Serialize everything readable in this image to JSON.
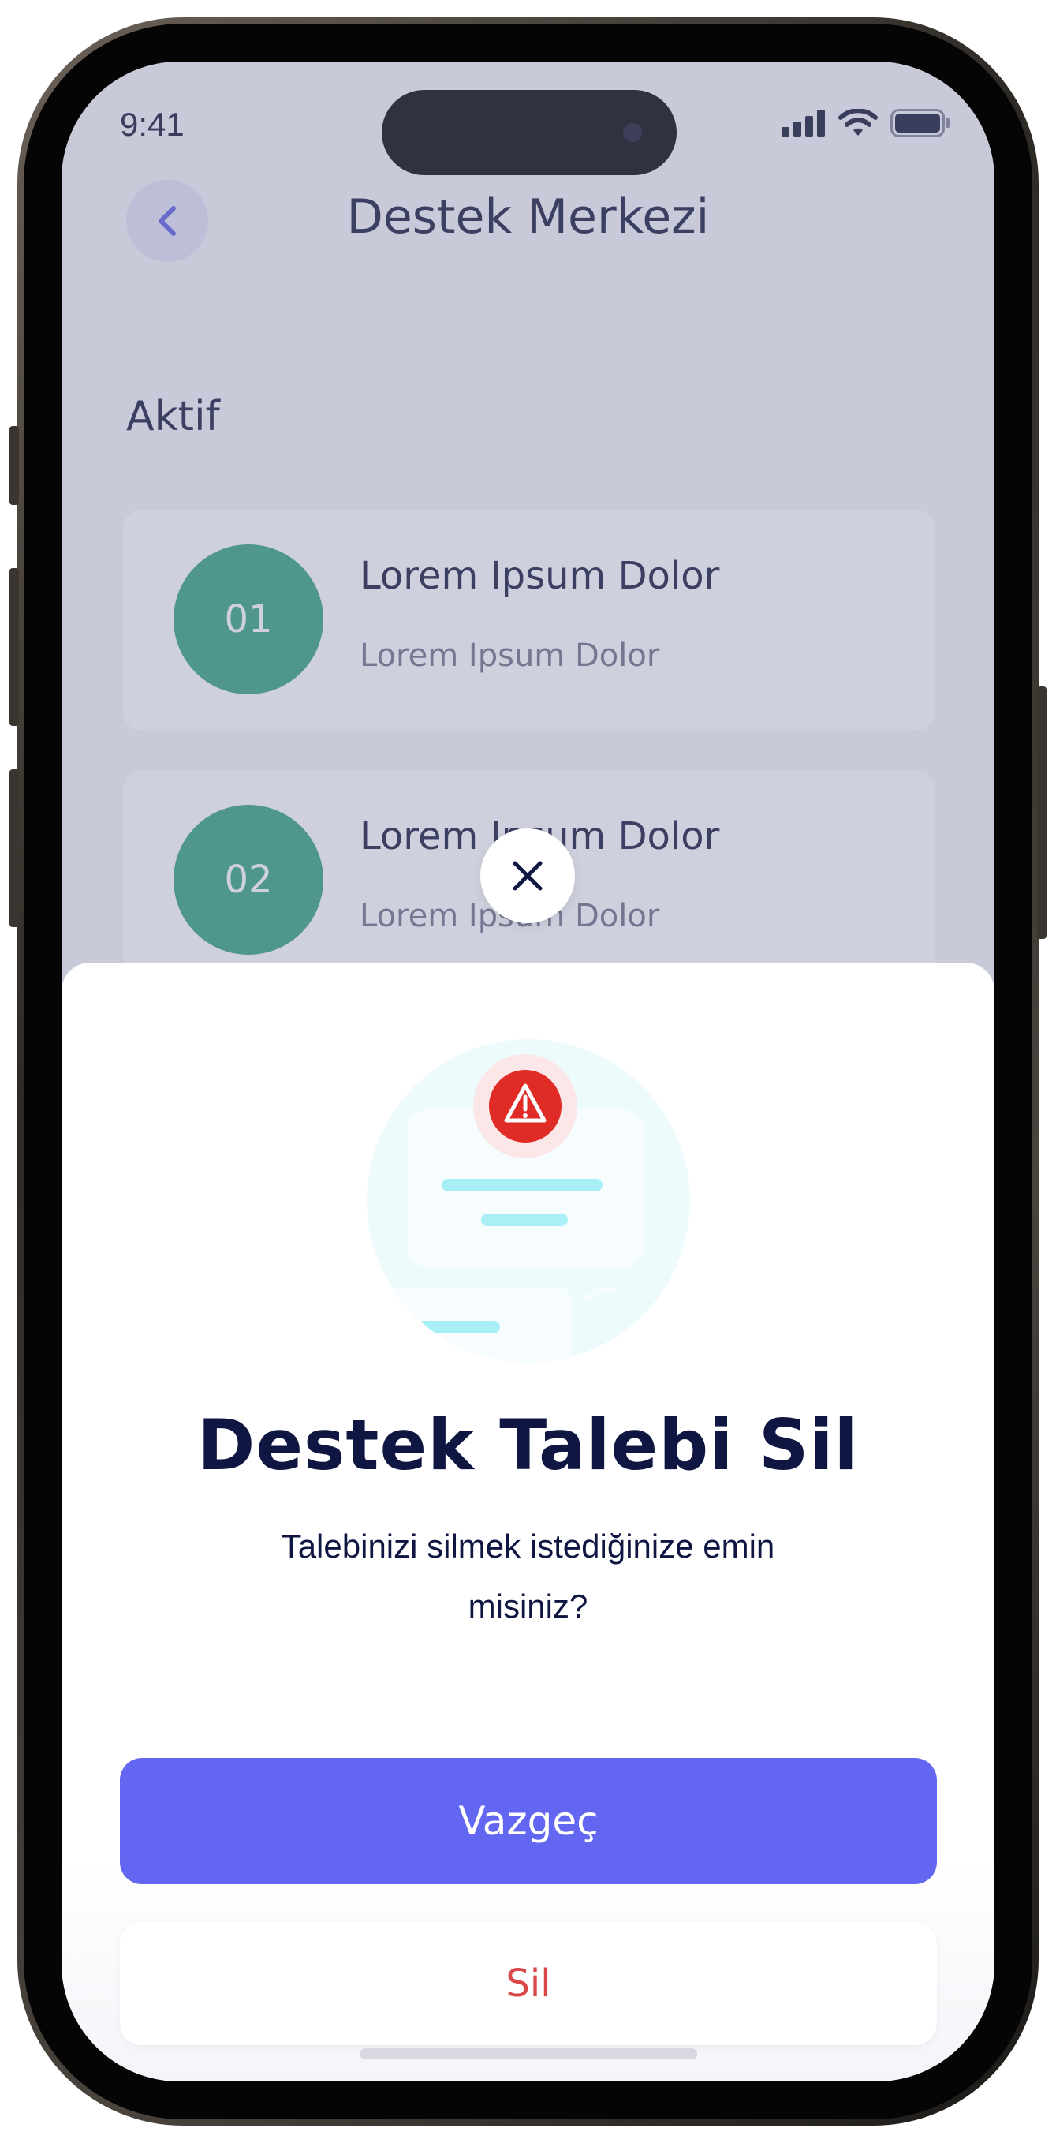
{
  "status_bar": {
    "time": "9:41"
  },
  "header": {
    "title": "Destek Merkezi"
  },
  "section": {
    "label": "Aktif"
  },
  "tickets": [
    {
      "number": "01",
      "title": "Lorem Ipsum Dolor",
      "subtitle": "Lorem Ipsum Dolor"
    },
    {
      "number": "02",
      "title": "Lorem Ipsum Dolor",
      "subtitle": "Lorem Ipsum Dolor"
    }
  ],
  "dialog": {
    "title": "Destek Talebi Sil",
    "message": "Talebinizi silmek istediğinize emin misiniz?",
    "cancel_label": "Vazgeç",
    "delete_label": "Sil"
  },
  "icons": {
    "back": "chevron-left-icon",
    "close": "close-icon",
    "warning": "warning-icon",
    "signal": "cellular-signal-icon",
    "wifi": "wifi-icon",
    "battery": "battery-icon"
  },
  "colors": {
    "accent": "#6366f1",
    "danger": "#d94848",
    "ticket_badge": "#30a37a",
    "warning": "#e02b26",
    "text_dark": "#0f1641"
  }
}
